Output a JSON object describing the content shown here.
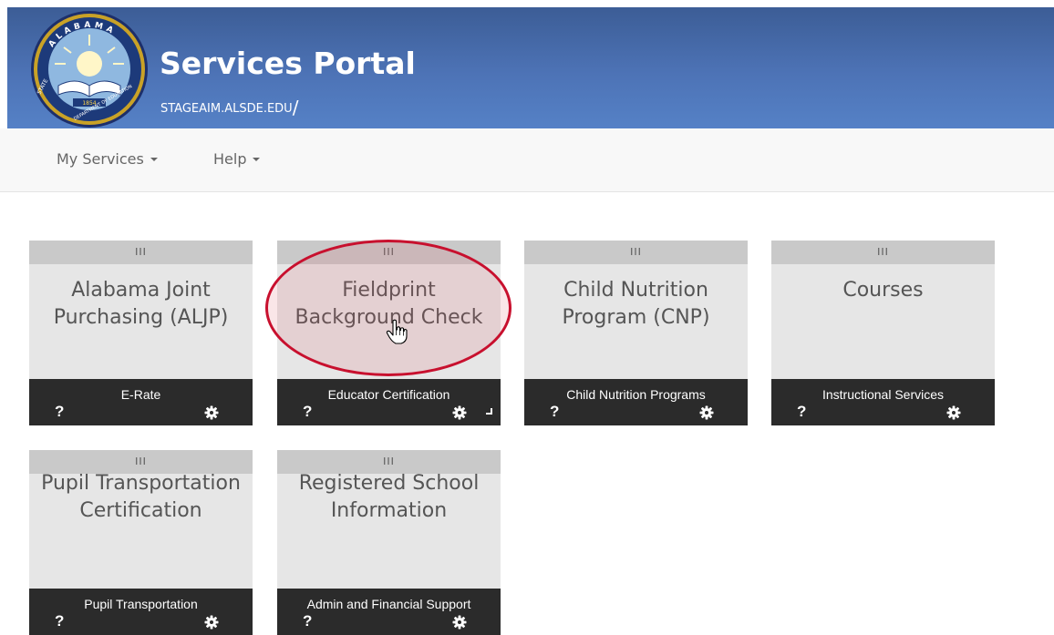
{
  "header": {
    "title": "Services Portal",
    "subtitle": "STAGEAIM.ALSDE.EDU",
    "subtitle_suffix": "/",
    "seal": {
      "top_text": "ALABAMA",
      "left_text": "STATE",
      "right_text": "DEPARTMENT OF EDUCATION",
      "year": "1854",
      "icon": "open-book-sun-seal"
    }
  },
  "nav": {
    "my_services": "My Services",
    "help": "Help"
  },
  "tiles": [
    {
      "handle": "III",
      "title": "Alabama Joint Purchasing (ALJP)",
      "category": "E-Rate",
      "help": "?"
    },
    {
      "handle": "III",
      "title": "Fieldprint Background Check",
      "category": "Educator Certification",
      "help": "?"
    },
    {
      "handle": "III",
      "title": "Child Nutrition Program (CNP)",
      "category": "Child Nutrition Programs",
      "help": "?"
    },
    {
      "handle": "III",
      "title": "Courses",
      "category": "Instructional Services",
      "help": "?"
    },
    {
      "handle": "III",
      "title": "Pupil Transportation Certification",
      "category": "Pupil Transportation",
      "help": "?"
    },
    {
      "handle": "III",
      "title": "Registered School Information",
      "category": "Admin and Financial Support",
      "help": "?"
    }
  ],
  "colors": {
    "header_top": "#3c5d96",
    "header_bottom": "#5581c6",
    "tile_body": "#e6e6e6",
    "tile_handle": "#c9c9c9",
    "tile_footer": "#2b2b2b",
    "highlight": "#c8102e"
  }
}
